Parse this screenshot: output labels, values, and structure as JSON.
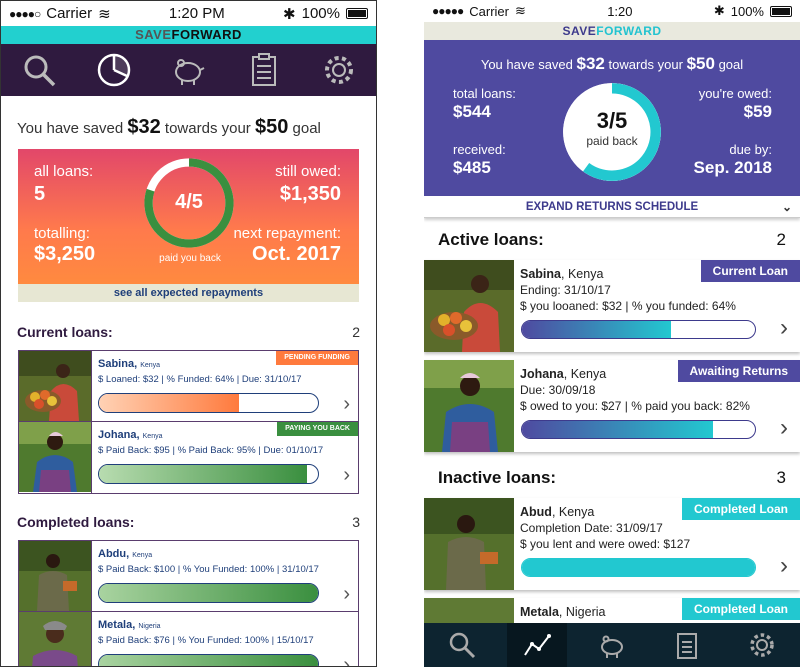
{
  "status": {
    "carrier": "Carrier",
    "battery": "100%"
  },
  "p1": {
    "time": "1:20 PM",
    "brand_a": "SAVE",
    "brand_b": "FORWARD",
    "nav_icons": [
      "search-icon",
      "pie-chart-icon",
      "piggy-bank-icon",
      "clipboard-icon",
      "gear-icon"
    ],
    "goal": {
      "pre": "You have saved",
      "saved": "$32",
      "mid": "towards your",
      "target": "$50",
      "post": "goal"
    },
    "summary": {
      "all_loans_label": "all loans:",
      "all_loans": "5",
      "still_owed_label": "still owed:",
      "still_owed": "$1,350",
      "totalling_label": "totalling:",
      "totalling": "$3,250",
      "next_label": "next repayment:",
      "next": "Oct. 2017",
      "ring_text": "4/5",
      "ring_progress": 0.8,
      "paid_label": "paid you back"
    },
    "see_all": "see all expected repayments",
    "current_title": "Current loans:",
    "current_count": "2",
    "current": [
      {
        "name": "Sabina",
        "country": "Kenya",
        "line": "$ Loaned: $32 | % Funded: 64% | Due: 31/10/17",
        "tag": "PENDING FUNDING",
        "tag_color": "#ff7a3d",
        "progress": 0.64,
        "bar": "orange"
      },
      {
        "name": "Johana",
        "country": "Kenya",
        "line": "$ Paid Back: $95 | % Paid Back: 95% | Due: 01/10/17",
        "tag": "PAYING YOU BACK",
        "tag_color": "#3a8f3f",
        "progress": 0.95,
        "bar": "green"
      }
    ],
    "completed_title": "Completed loans:",
    "completed_count": "3",
    "completed": [
      {
        "name": "Abdu",
        "country": "Kenya",
        "line": "$ Paid Back: $100 | % You Funded: 100% | 31/10/17",
        "progress": 1.0
      },
      {
        "name": "Metala",
        "country": "Nigeria",
        "line": "$ Paid Back: $76 | % You Funded: 100% | 15/10/17",
        "progress": 1.0
      }
    ]
  },
  "p2": {
    "time": "1:20",
    "brand_a": "SAVE",
    "brand_b": "FORWARD",
    "goal": {
      "pre": "You have saved",
      "saved": "$32",
      "mid": "towards your",
      "target": "$50",
      "post": "goal"
    },
    "summary": {
      "total_label": "total loans:",
      "total": "$544",
      "owed_label": "you're owed:",
      "owed": "$59",
      "received_label": "received:",
      "received": "$485",
      "due_label": "due by:",
      "due": "Sep. 2018",
      "ring_text": "3/5",
      "ring_progress": 0.6,
      "paid_label": "paid back"
    },
    "expand": "EXPAND RETURNS SCHEDULE",
    "active_title": "Active loans:",
    "active_count": "2",
    "active": [
      {
        "name": "Sabina",
        "country": "Kenya",
        "line1": "Ending: 31/10/17",
        "line2": "$ you looaned: $32 | % you funded: 64%",
        "tag": "Current Loan",
        "tag_color": "#4f4aa0",
        "progress": 0.64
      },
      {
        "name": "Johana",
        "country": "Kenya",
        "line1": "Due: 30/09/18",
        "line2": "$ owed to you: $27 | % paid you back: 82%",
        "tag": "Awaiting Returns",
        "tag_color": "#4f4aa0",
        "progress": 0.82
      }
    ],
    "inactive_title": "Inactive loans:",
    "inactive_count": "3",
    "inactive": [
      {
        "name": "Abud",
        "country": "Kenya",
        "line1": "Completion Date: 31/09/17",
        "line2": "$ you lent and were owed: $127",
        "tag": "Completed Loan",
        "tag_color": "#22c8d0",
        "progress": 1.0
      },
      {
        "name": "Metala",
        "country": "Nigeria",
        "tag": "Completed Loan",
        "tag_color": "#22c8d0"
      }
    ],
    "tab_icons": [
      "search-icon",
      "line-chart-icon",
      "piggy-bank-icon",
      "clipboard-icon",
      "gear-icon"
    ]
  }
}
